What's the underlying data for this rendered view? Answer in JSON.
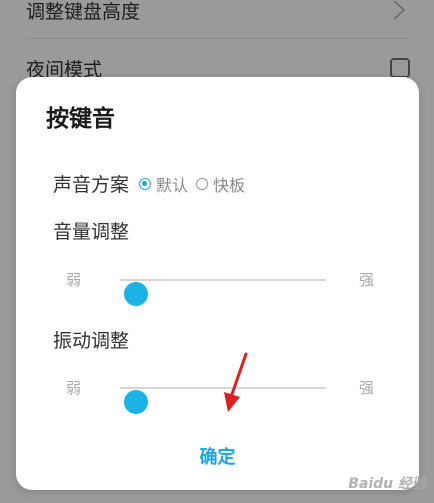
{
  "background": {
    "row_keyboard_height": "调整键盘高度",
    "row_night_mode": "夜间模式",
    "night_mode_checked": false
  },
  "dialog": {
    "title": "按键音",
    "scheme": {
      "label": "声音方案",
      "options": [
        "默认",
        "快板"
      ],
      "selected": "默认"
    },
    "volume": {
      "label": "音量调整",
      "min_label": "弱",
      "max_label": "强",
      "value": 0.08
    },
    "vibration": {
      "label": "振动调整",
      "min_label": "弱",
      "max_label": "强",
      "value": 0.08
    },
    "confirm_label": "确定"
  },
  "colors": {
    "accent": "#1ba6e6",
    "thumb": "#1bb2e6",
    "annotation_arrow": "#e01e1e"
  },
  "watermark_text": "Baidu 经验"
}
